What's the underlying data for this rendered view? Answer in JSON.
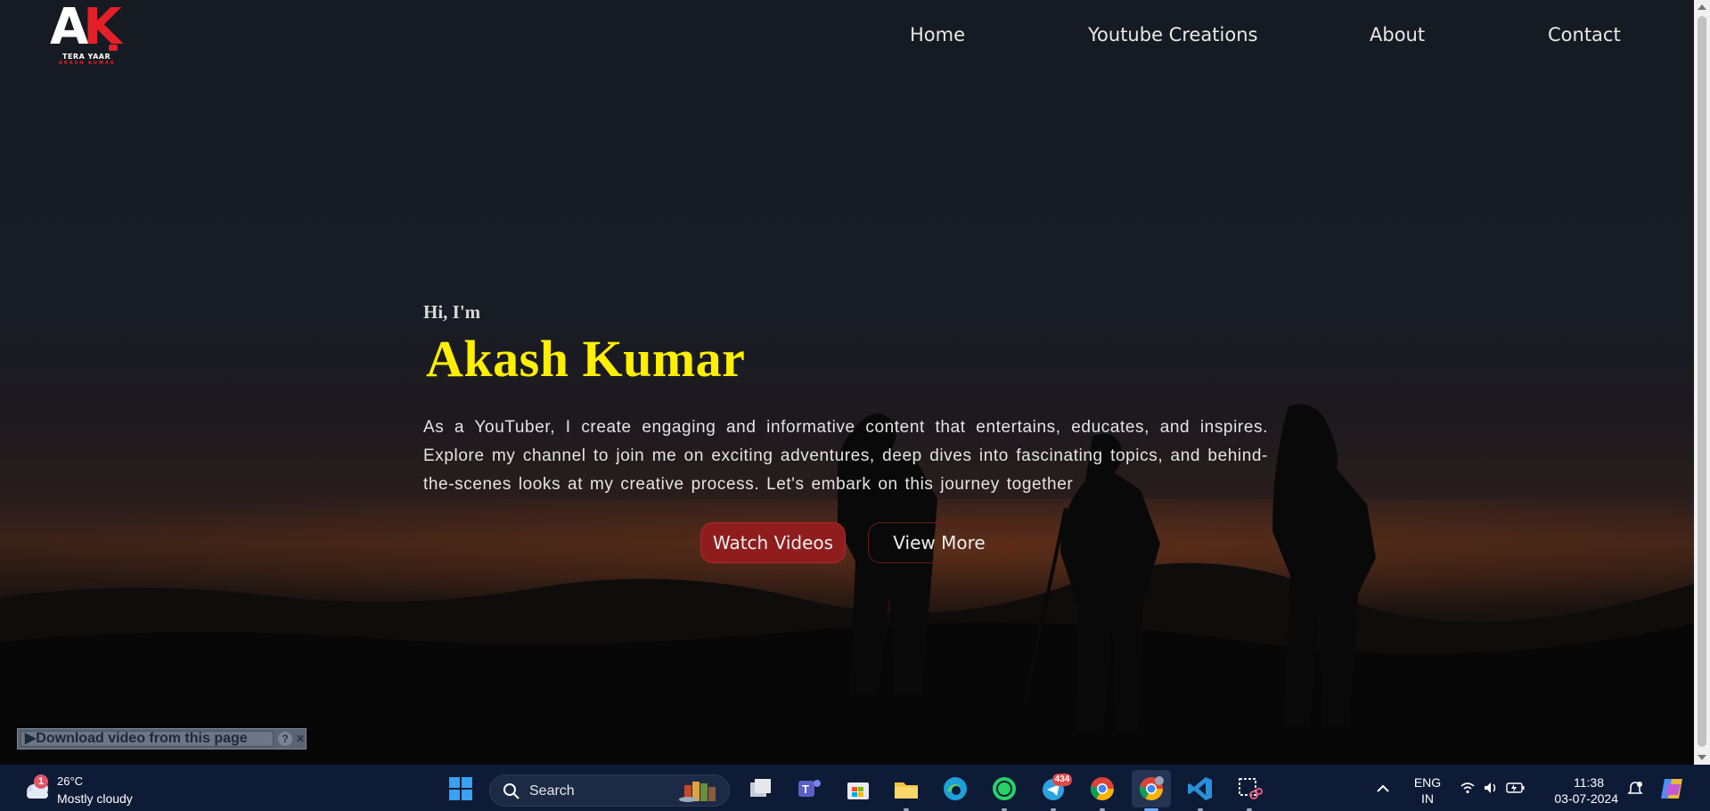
{
  "brand": {
    "logo_a": "A",
    "logo_k": "K",
    "tagline": "TERA YAAR",
    "subtag": "AKASH KUMAR"
  },
  "nav": {
    "home": "Home",
    "youtube": "Youtube Creations",
    "about": "About",
    "contact": "Contact"
  },
  "hero": {
    "greeting": "Hi, I'm",
    "name": "Akash Kumar",
    "description": "As a YouTuber, I create engaging and informative content that entertains, educates, and inspires. Explore my channel to join me on exciting adventures, deep dives into fascinating topics, and behind-the-scenes looks at my creative process. Let's embark on this journey together",
    "watch_button": "Watch Videos",
    "more_button": "View More"
  },
  "download_bar": {
    "label": "▶Download video from this page",
    "help": "?",
    "close": "✕"
  },
  "taskbar": {
    "weather_badge": "1",
    "temperature": "26°C",
    "condition": "Mostly cloudy",
    "search_placeholder": "Search",
    "telegram_badge": "434",
    "lang_top": "ENG",
    "lang_bottom": "IN",
    "time": "11:38",
    "date": "03-07-2024",
    "icons": [
      "start-icon",
      "search-icon",
      "task-view-icon",
      "teams-icon",
      "store-icon",
      "file-explorer-icon",
      "edge-icon",
      "whatsapp-icon",
      "telegram-icon",
      "chrome-icon",
      "chrome-profile-icon",
      "vscode-icon",
      "snipping-tool-icon",
      "chevron-up-icon",
      "wifi-icon",
      "volume-icon",
      "battery-icon",
      "notification-icon",
      "copilot-icon"
    ]
  },
  "colors": {
    "accent_red": "#8f1d1d",
    "name_yellow": "#ffef00",
    "taskbar_bg": "#0e1b36"
  }
}
